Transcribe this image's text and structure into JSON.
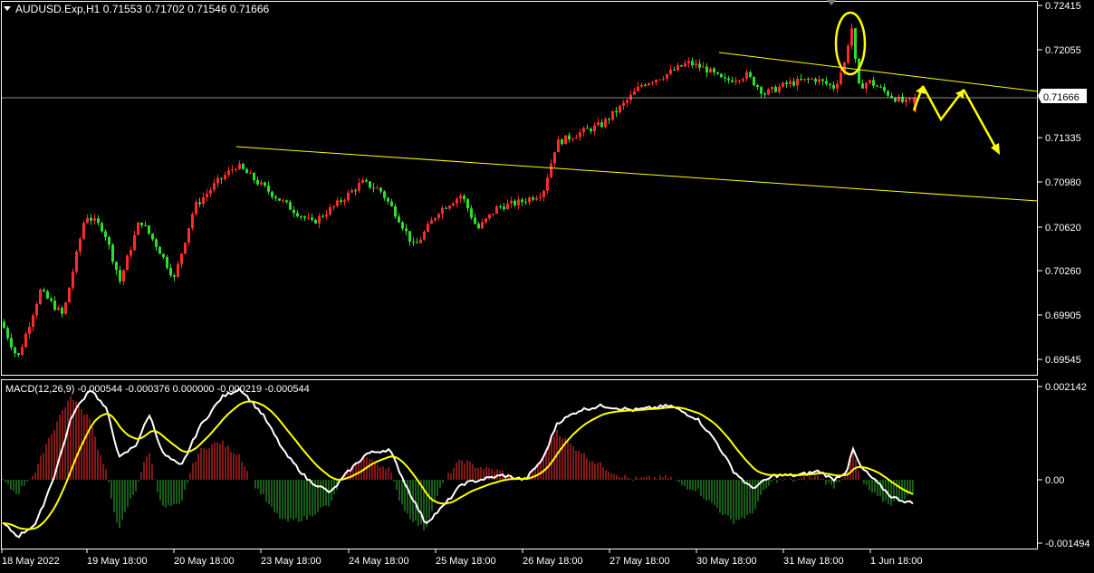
{
  "main_chart": {
    "symbol_line": "AUDUSD.Exp,H1  0.71553 0.71702 0.71546 0.71666",
    "y_ticks": [
      "0.72415",
      "0.72055",
      "0.71335",
      "0.70980",
      "0.70620",
      "0.70260",
      "0.69905",
      "0.69545"
    ],
    "current_price_label": "0.71666",
    "colors": {
      "bull": "#FF2A2A",
      "bear": "#2AE02A",
      "trendline": "#FFFF00",
      "grid": "#FFFFFF",
      "background": "#000000"
    }
  },
  "macd_panel": {
    "label": "MACD(12,26,9) -0.000544 -0.000376 0.000000 -0.000219 -0.000544",
    "y_ticks": [
      "0.002142",
      "0.00",
      "-0.001494"
    ],
    "colors": {
      "hist_pos": "#FF3030",
      "hist_neg": "#2EB82E",
      "macd_line": "#FFFFFF",
      "signal_line": "#FFFF00"
    }
  },
  "x_axis": {
    "labels": [
      "18 May 2022",
      "19 May 18:00",
      "20 May 18:00",
      "23 May 18:00",
      "24 May 18:00",
      "25 May 18:00",
      "26 May 18:00",
      "27 May 18:00",
      "30 May 18:00",
      "31 May 18:00",
      "1 Jun 18:00"
    ]
  },
  "chart_data": {
    "type": "candlestick",
    "symbol": "AUDUSD.Exp",
    "timeframe": "H1",
    "last_bar": {
      "open": 0.71553,
      "high": 0.71702,
      "low": 0.71546,
      "close": 0.71666
    },
    "current_price": 0.71666,
    "ylim": [
      0.69545,
      0.72415
    ],
    "close_path": [
      {
        "x": "18 May 2022",
        "y": 0.6985
      },
      {
        "x": "19 May 18:00",
        "y": 0.7072
      },
      {
        "x": "20 May 18:00",
        "y": 0.7053
      },
      {
        "x": "23 May 18:00",
        "y": 0.7112
      },
      {
        "x": "24 May 18:00",
        "y": 0.709
      },
      {
        "x": "25 May 18:00",
        "y": 0.7075
      },
      {
        "x": "26 May 18:00",
        "y": 0.7098
      },
      {
        "x": "27 May 18:00",
        "y": 0.7168
      },
      {
        "x": "30 May 18:00",
        "y": 0.7185
      },
      {
        "x": "31 May 18:00",
        "y": 0.7178
      },
      {
        "x": "1 Jun 18:00",
        "y": 0.7166
      }
    ],
    "macd": {
      "name": "MACD(12,26,9)",
      "ylim": [
        -0.001494,
        0.002142
      ]
    }
  }
}
